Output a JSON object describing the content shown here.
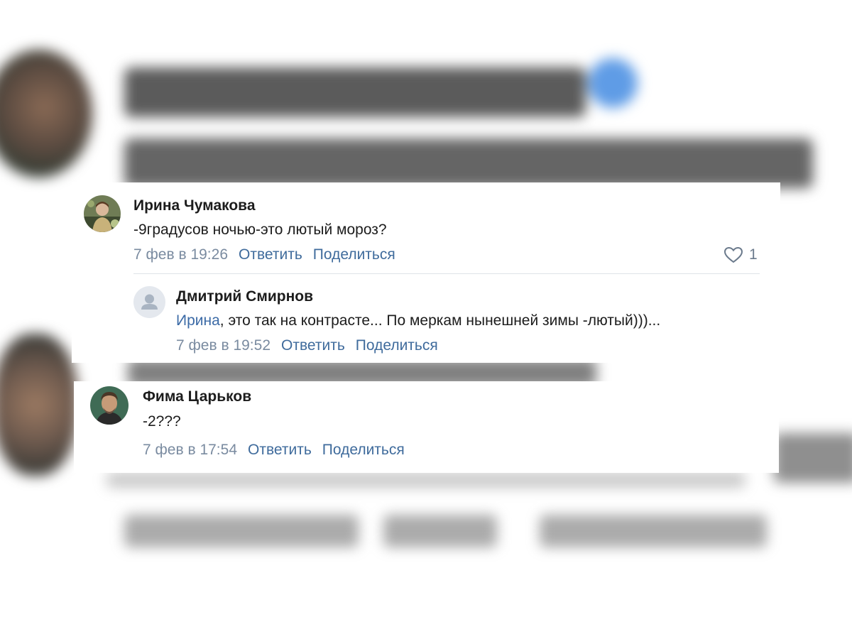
{
  "comments": [
    {
      "author": "Ирина Чумакова",
      "text": "-9градусов ночью-это лютый мороз?",
      "date": "7 фев в 19:26",
      "reply_label": "Ответить",
      "share_label": "Поделиться",
      "likes": "1",
      "replies": [
        {
          "author": "Дмитрий Смирнов",
          "mention": "Ирина",
          "text": ", это так на контрасте... По меркам нынешней зимы -лютый)))...",
          "date": "7 фев в 19:52",
          "reply_label": "Ответить",
          "share_label": "Поделиться"
        }
      ]
    },
    {
      "author": "Фима Царьков",
      "text": "-2???",
      "date": "7 фев в 17:54",
      "reply_label": "Ответить",
      "share_label": "Поделиться"
    }
  ],
  "icons": {
    "like": "heart-icon",
    "placeholder_avatar": "user-silhouette-icon"
  },
  "colors": {
    "link": "#3f6b9c",
    "date": "#7a8ba0",
    "text": "#1c1c1c",
    "mention": "#3b6aa6"
  }
}
